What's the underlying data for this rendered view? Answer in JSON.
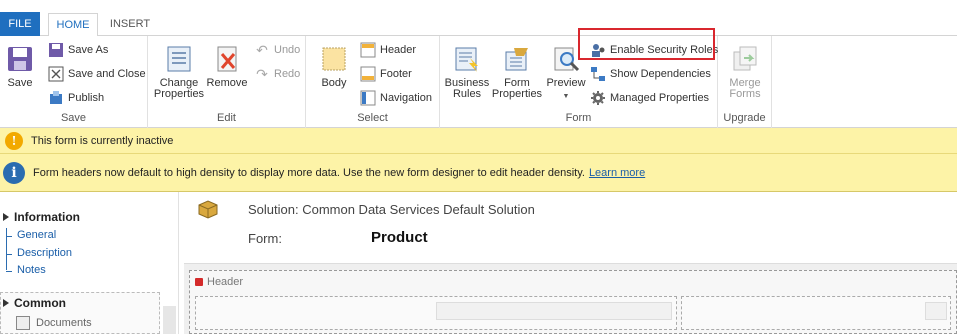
{
  "tabs": {
    "file": "FILE",
    "home": "HOME",
    "insert": "INSERT"
  },
  "ribbon": {
    "save_group": {
      "label": "Save",
      "save": "Save",
      "save_as": "Save As",
      "save_and_close": "Save and Close",
      "publish": "Publish"
    },
    "edit_group": {
      "label": "Edit",
      "change_properties_1": "Change",
      "change_properties_2": "Properties",
      "remove": "Remove",
      "undo": "Undo",
      "redo": "Redo"
    },
    "select_group": {
      "label": "Select",
      "body": "Body",
      "header": "Header",
      "footer": "Footer",
      "navigation": "Navigation"
    },
    "form_group": {
      "label": "Form",
      "business_rules_1": "Business",
      "business_rules_2": "Rules",
      "form_properties_1": "Form",
      "form_properties_2": "Properties",
      "preview": "Preview",
      "enable_security_roles": "Enable Security Roles",
      "show_dependencies": "Show Dependencies",
      "managed_properties": "Managed Properties"
    },
    "upgrade_group": {
      "label": "Upgrade",
      "merge_forms_1": "Merge",
      "merge_forms_2": "Forms"
    }
  },
  "notifications": {
    "inactive": "This form is currently inactive",
    "density": "Form headers now default to high density to display more data. Use the new form designer to edit header density.",
    "learn_more": "Learn more"
  },
  "nav": {
    "information": "Information",
    "general": "General",
    "description": "Description",
    "notes": "Notes",
    "common": "Common",
    "documents": "Documents"
  },
  "form": {
    "solution": "Solution: Common Data Services Default Solution",
    "form_label": "Form:",
    "form_name": "Product",
    "header_label": "Header"
  },
  "colors": {
    "accent": "#1f6fbf",
    "highlight": "#d9272e",
    "notification_bg": "#fdf3a7"
  }
}
